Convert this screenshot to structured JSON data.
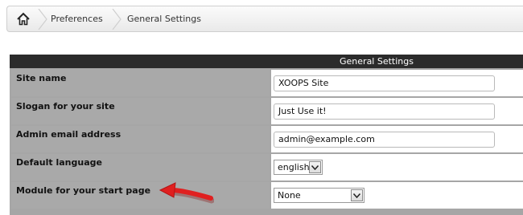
{
  "breadcrumb": {
    "home_icon": "home-icon",
    "items": [
      "Preferences",
      "General Settings"
    ]
  },
  "panel": {
    "title": "General Settings",
    "rows": [
      {
        "label": "Site name",
        "value": "XOOPS Site"
      },
      {
        "label": "Slogan for your site",
        "value": "Just Use it!"
      },
      {
        "label": "Admin email address",
        "value": "admin@example.com"
      },
      {
        "label": "Default language",
        "value": "english"
      },
      {
        "label": "Module for your start page",
        "value": "None"
      }
    ]
  },
  "colors": {
    "header_bg": "#2b2b2b",
    "label_bg": "#a9a9a9",
    "arrow_red": "#e02020"
  }
}
